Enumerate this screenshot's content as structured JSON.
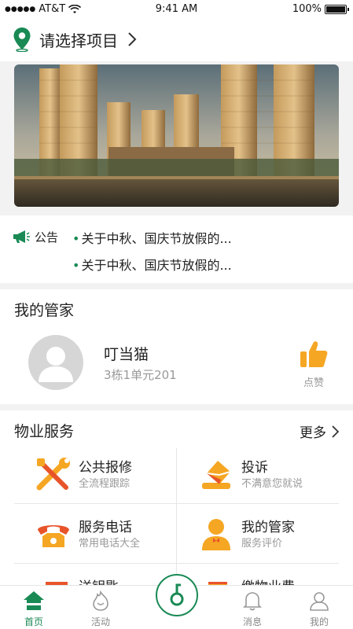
{
  "status_bar": {
    "carrier": "AT&T",
    "signal": "●●●●●",
    "time": "9:41 AM",
    "battery": "100%"
  },
  "header": {
    "title": "请选择项目"
  },
  "notice": {
    "label": "公告",
    "items": [
      "关于中秋、国庆节放假的...",
      "关于中秋、国庆节放假的..."
    ]
  },
  "butler": {
    "section_title": "我的管家",
    "name": "叮当猫",
    "address": "3栋1单元201",
    "like_label": "点赞"
  },
  "services": {
    "section_title": "物业服务",
    "more_label": "更多",
    "items": [
      {
        "title": "公共报修",
        "subtitle": "全流程跟踪",
        "icon": "wrench-icon"
      },
      {
        "title": "投诉",
        "subtitle": "不满意您就说",
        "icon": "mail-icon"
      },
      {
        "title": "服务电话",
        "subtitle": "常用电话大全",
        "icon": "phone-icon"
      },
      {
        "title": "我的管家",
        "subtitle": "服务评价",
        "icon": "butler-icon"
      },
      {
        "title": "送钥匙",
        "subtitle": "",
        "icon": "key-card-icon"
      },
      {
        "title": "缴物业费",
        "subtitle": "",
        "icon": "wallet-icon"
      }
    ]
  },
  "tabbar": {
    "items": [
      {
        "label": "首页",
        "icon": "home-icon"
      },
      {
        "label": "活动",
        "icon": "activity-icon"
      },
      {
        "label": "",
        "icon": "key-icon"
      },
      {
        "label": "消息",
        "icon": "bell-icon"
      },
      {
        "label": "我的",
        "icon": "user-icon"
      }
    ]
  },
  "colors": {
    "accent": "#1a8a55",
    "icon_orange": "#f5a623",
    "icon_red": "#e8542a"
  }
}
